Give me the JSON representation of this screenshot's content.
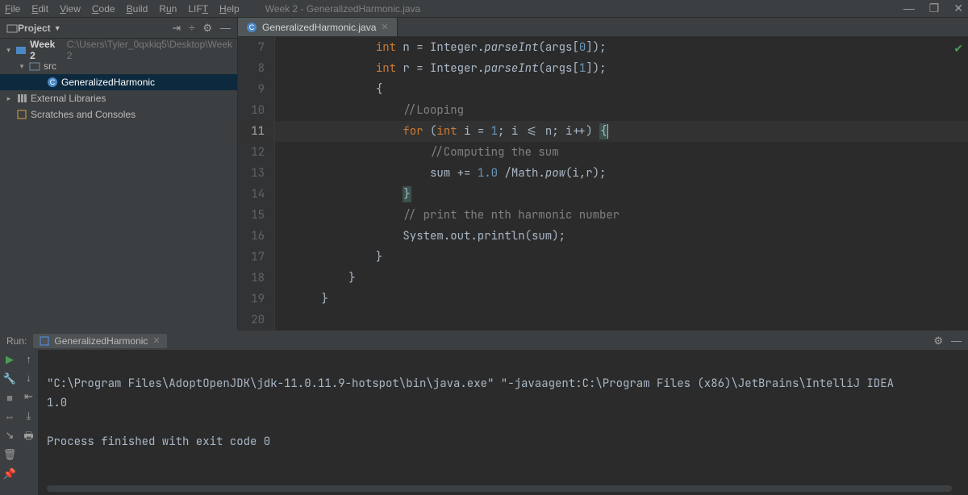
{
  "menubar": {
    "items": [
      "File",
      "Edit",
      "View",
      "Code",
      "Build",
      "Run",
      "LIFT",
      "Help"
    ],
    "title_path": "Week 2 - GeneralizedHarmonic.java"
  },
  "project_panel": {
    "title": "Project",
    "root": {
      "name": "Week 2",
      "path": "C:\\Users\\Tyler_0qxkiq5\\Desktop\\Week 2"
    },
    "src_label": "src",
    "class_label": "GeneralizedHarmonic",
    "external_libs": "External Libraries",
    "scratches": "Scratches and Consoles"
  },
  "editor": {
    "tab": {
      "label": "GeneralizedHarmonic.java"
    },
    "lines": [
      {
        "n": 7,
        "html": "            <span class='kw'>int</span> <span class='plain'>n = </span><span class='plain'>Integer</span><span class='plain'>.</span><span class='fn'>parseInt</span><span class='plain'>(args[</span><span class='num'>0</span><span class='plain'>]);</span>"
      },
      {
        "n": 8,
        "html": "            <span class='kw'>int</span> <span class='plain'>r = </span><span class='plain'>Integer</span><span class='plain'>.</span><span class='fn'>parseInt</span><span class='plain'>(args[</span><span class='num'>1</span><span class='plain'>]);</span>"
      },
      {
        "n": 9,
        "html": "            <span class='brc'>{</span>"
      },
      {
        "n": 10,
        "html": "                <span class='cmt'>//Looping</span>"
      },
      {
        "n": 11,
        "current": true,
        "html": "                <span class='kw'>for</span> <span class='plain'>(</span><span class='kw'>int</span><span class='plain'> i = </span><span class='num'>1</span><span class='plain'>; i &lt;= n; i++) </span><span class='brc hlbrace'>{</span><span class='caret'></span>"
      },
      {
        "n": 12,
        "html": "                    <span class='cmt'>//Computing the sum</span>"
      },
      {
        "n": 13,
        "html": "                    <span class='plain'>sum += </span><span class='num'>1.0</span><span class='plain'> /Math.</span><span class='fn'>pow</span><span class='plain'>(i,r);</span>"
      },
      {
        "n": 14,
        "html": "                <span class='brc hlbrace'>}</span>"
      },
      {
        "n": 15,
        "html": "                <span class='cmt'>// print the nth harmonic number</span>"
      },
      {
        "n": 16,
        "html": "                <span class='plain'>System.out.println(sum);</span>"
      },
      {
        "n": 17,
        "html": "            <span class='brc'>}</span>"
      },
      {
        "n": 18,
        "html": "        <span class='brc'>}</span>"
      },
      {
        "n": 19,
        "html": "    <span class='brc'>}</span>"
      },
      {
        "n": 20,
        "html": ""
      }
    ]
  },
  "run": {
    "label": "Run:",
    "tab": "GeneralizedHarmonic",
    "output_cmd": "\"C:\\Program Files\\AdoptOpenJDK\\jdk-11.0.11.9-hotspot\\bin\\java.exe\" \"-javaagent:C:\\Program Files (x86)\\JetBrains\\IntelliJ IDEA",
    "output_val": "1.0",
    "output_exit": "Process finished with exit code 0"
  }
}
